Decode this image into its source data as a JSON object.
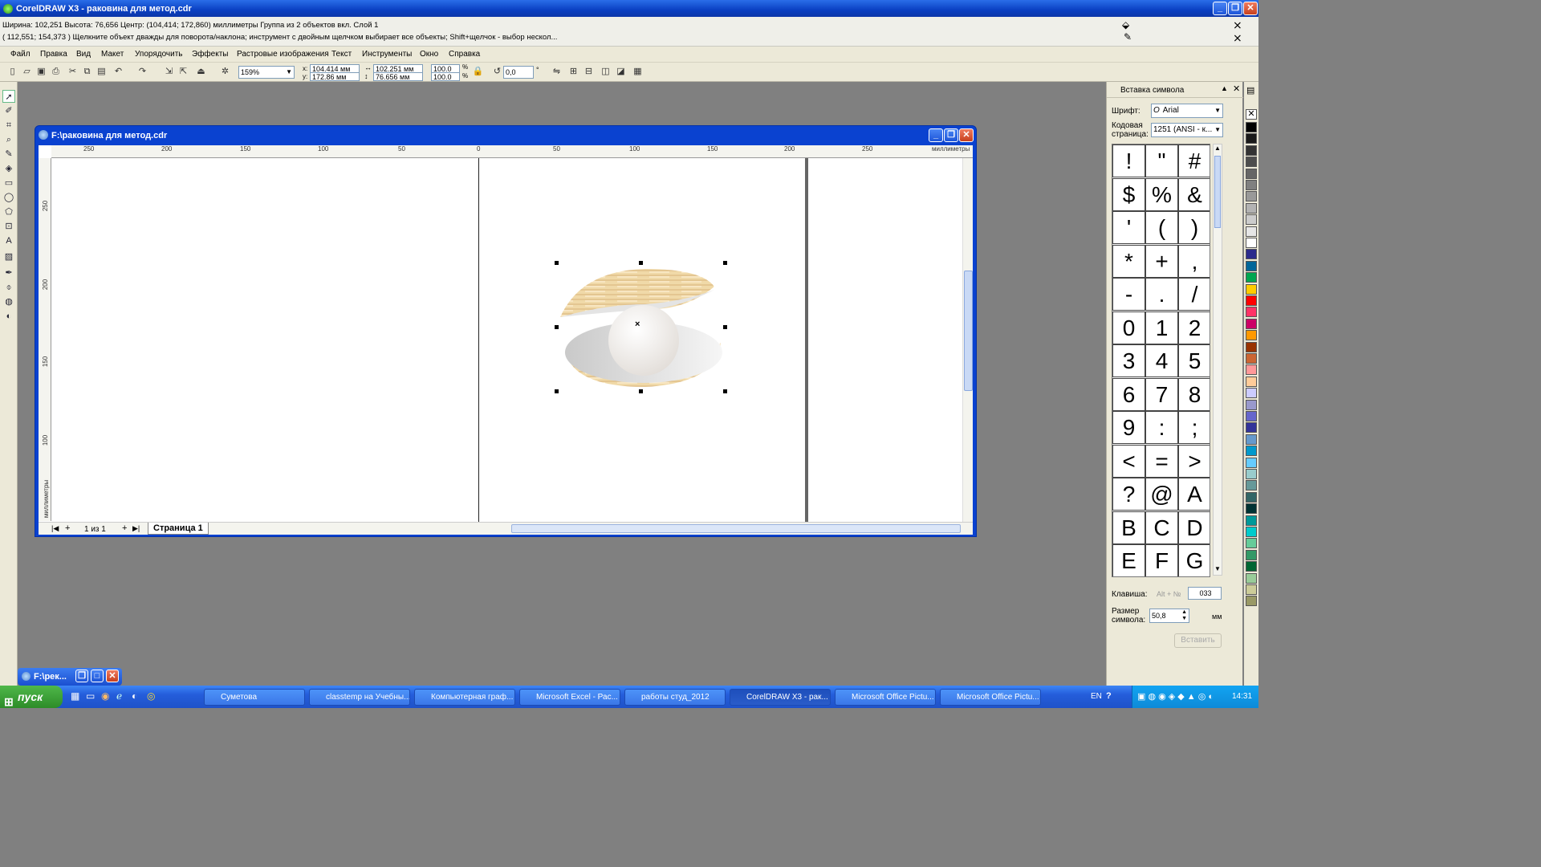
{
  "app": {
    "title": "CorelDRAW X3 - раковина для метод.cdr"
  },
  "info": {
    "line1": "Ширина: 102,251  Высота: 76,656  Центр: (104,414; 172,860)  миллиметры        Группа из 2 объектов вкл. Слой 1",
    "line2": "( 112,551; 154,373 )     Щелкните объект дважды для поворота/наклона; инструмент с двойным щелчком выбирает все объекты; Shift+щелчок - выбор нескол..."
  },
  "menu": [
    "Файл",
    "Правка",
    "Вид",
    "Макет",
    "Упорядочить",
    "Эффекты",
    "Растровые изображения",
    "Текст",
    "Инструменты",
    "Окно",
    "Справка"
  ],
  "toolbar": {
    "zoom": "159%",
    "x": "104.414 мм",
    "y": "172.86 мм",
    "w": "102.251 мм",
    "h": "76.656 мм",
    "sx": "100.0",
    "sy": "100.0",
    "pct1": "%",
    "pct2": "%",
    "angle": "0,0",
    "deg": "°"
  },
  "doc": {
    "title": "F:\\раковина для метод.cdr",
    "ruler_units": "миллиметры",
    "hticks": [
      "250",
      "200",
      "150",
      "100",
      "50",
      "0",
      "50",
      "100",
      "150",
      "200",
      "250"
    ],
    "vticks": [
      "250",
      "200",
      "150",
      "100"
    ],
    "vunits": "миллиметры",
    "page_count": "1 из 1",
    "page_tab": "Страница 1"
  },
  "docker": {
    "title": "Вставка символа",
    "font_label": "Шрифт:",
    "font_value": "Arial",
    "codepage_label": "Кодовая страница:",
    "codepage_value": "1251  (ANSI - к...",
    "chars": [
      "!",
      "\"",
      "#",
      "$",
      "%",
      "&",
      "'",
      "(",
      ")",
      "*",
      "+",
      ",",
      "-",
      ".",
      "/",
      "0",
      "1",
      "2",
      "3",
      "4",
      "5",
      "6",
      "7",
      "8",
      "9",
      ":",
      ";",
      "<",
      "=",
      ">",
      "?",
      "@",
      "A",
      "B",
      "C",
      "D",
      "E",
      "F",
      "G"
    ],
    "key_label": "Клавиша:",
    "alt_label": "Alt + №",
    "key_value": "033",
    "size_label": "Размер символа:",
    "size_value": "50,8",
    "size_unit": "мм",
    "insert_btn": "Вставить"
  },
  "palette": [
    "#000000",
    "#1a1a1a",
    "#333333",
    "#4d4d4d",
    "#666666",
    "#808080",
    "#999999",
    "#b3b3b3",
    "#cccccc",
    "#e6e6e6",
    "#ffffff",
    "#2b2b8c",
    "#006699",
    "#00a650",
    "#ffcc00",
    "#ff0000",
    "#ff3366",
    "#cc0066",
    "#ff9900",
    "#993300",
    "#cc6633",
    "#ff9999",
    "#ffcc99",
    "#ccccff",
    "#9999cc",
    "#6666cc",
    "#333399",
    "#6699cc",
    "#0099cc",
    "#66ccff",
    "#99cccc",
    "#669999",
    "#336666",
    "#003333",
    "#009999",
    "#00cccc",
    "#66cc99",
    "#339966",
    "#006633",
    "#99cc99",
    "#cccc99",
    "#999966"
  ],
  "minidoc": "F:\\рек...",
  "taskbar": {
    "start": "пуск",
    "tasks": [
      "Суметова",
      "classtemp на Учебны...",
      "Компьютерная граф...",
      "Microsoft Excel - Рас...",
      "работы студ_2012",
      "CorelDRAW X3 - рак...",
      "Microsoft Office Pictu...",
      "Microsoft Office Pictu..."
    ],
    "lang": "EN",
    "clock": "14:31"
  }
}
